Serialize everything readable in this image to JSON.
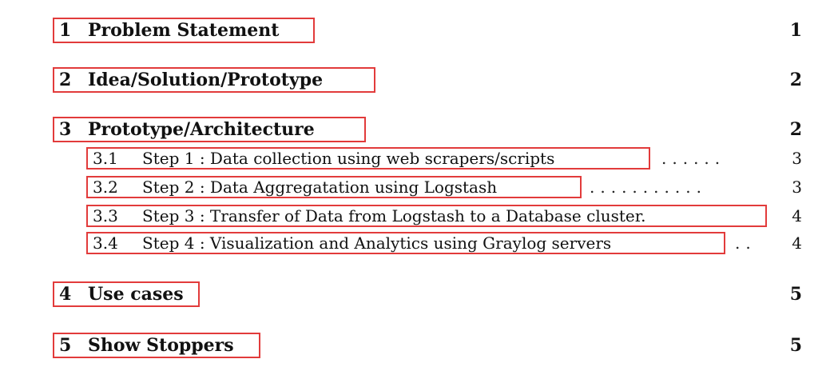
{
  "toc": {
    "sections": [
      {
        "number": "1",
        "title": "Problem Statement",
        "page": "1"
      },
      {
        "number": "2",
        "title": "Idea/Solution/Prototype",
        "page": "2"
      },
      {
        "number": "3",
        "title": "Prototype/Architecture",
        "page": "2"
      },
      {
        "number": "4",
        "title": "Use cases",
        "page": "5"
      },
      {
        "number": "5",
        "title": "Show Stoppers",
        "page": "5"
      }
    ],
    "subsections": [
      {
        "number": "3.1",
        "title": "Step 1 : Data collection using web scrapers/scripts",
        "leader": "......",
        "page": "3"
      },
      {
        "number": "3.2",
        "title": "Step 2 : Data Aggregatation using Logstash",
        "leader": "...........",
        "page": "3"
      },
      {
        "number": "3.3",
        "title": "Step 3 : Transfer of Data from Logstash to a Database cluster.",
        "leader": "",
        "page": "4"
      },
      {
        "number": "3.4",
        "title": "Step 4 : Visualization and Analytics using Graylog servers",
        "leader": "..",
        "page": "4"
      }
    ]
  }
}
